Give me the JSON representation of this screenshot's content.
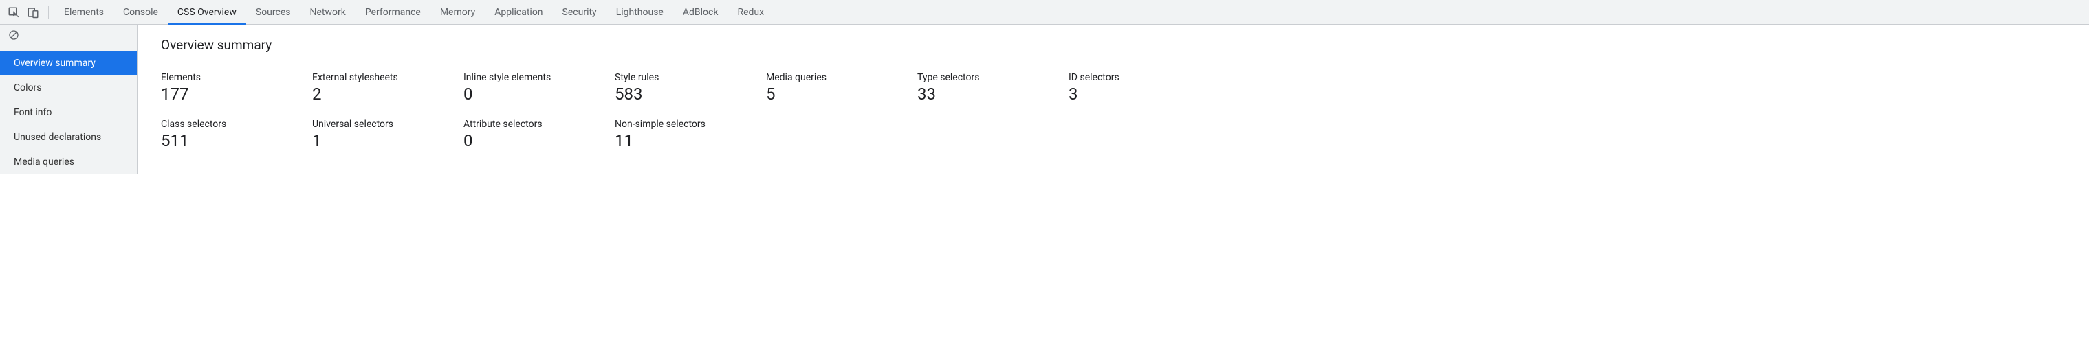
{
  "tabs": {
    "items": [
      {
        "label": "Elements"
      },
      {
        "label": "Console"
      },
      {
        "label": "CSS Overview",
        "active": true
      },
      {
        "label": "Sources"
      },
      {
        "label": "Network"
      },
      {
        "label": "Performance"
      },
      {
        "label": "Memory"
      },
      {
        "label": "Application"
      },
      {
        "label": "Security"
      },
      {
        "label": "Lighthouse"
      },
      {
        "label": "AdBlock"
      },
      {
        "label": "Redux"
      }
    ]
  },
  "sidebar": {
    "items": [
      {
        "label": "Overview summary",
        "active": true
      },
      {
        "label": "Colors"
      },
      {
        "label": "Font info"
      },
      {
        "label": "Unused declarations"
      },
      {
        "label": "Media queries"
      }
    ]
  },
  "main": {
    "title": "Overview summary",
    "stats": [
      {
        "label": "Elements",
        "value": "177"
      },
      {
        "label": "External stylesheets",
        "value": "2"
      },
      {
        "label": "Inline style elements",
        "value": "0"
      },
      {
        "label": "Style rules",
        "value": "583"
      },
      {
        "label": "Media queries",
        "value": "5"
      },
      {
        "label": "Type selectors",
        "value": "33"
      },
      {
        "label": "ID selectors",
        "value": "3"
      },
      {
        "label": "Class selectors",
        "value": "511"
      },
      {
        "label": "Universal selectors",
        "value": "1"
      },
      {
        "label": "Attribute selectors",
        "value": "0"
      },
      {
        "label": "Non-simple selectors",
        "value": "11"
      }
    ]
  }
}
